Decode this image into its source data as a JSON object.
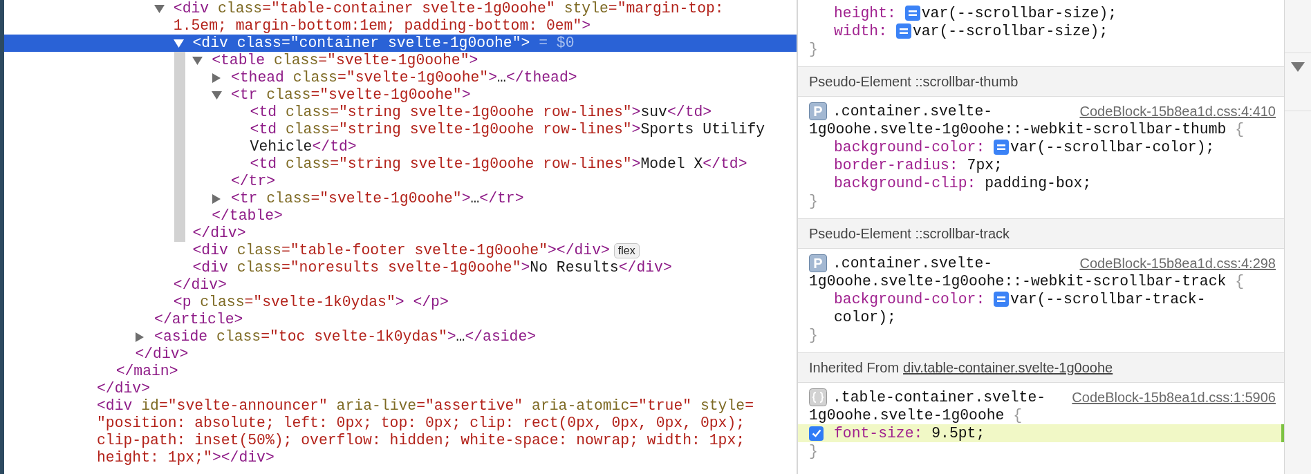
{
  "dom_tree": [
    {
      "children": [
        {
          "children": [
            {
              "children": [
                {
                  "children": [
                    {
                      "selected": false,
                      "expanded": true,
                      "lines": [
                        [
                          {
                            "kind": "tag",
                            "text": "<div"
                          },
                          {
                            "kind": "attr",
                            "text": " class"
                          },
                          {
                            "kind": "value",
                            "text": "=\"table-container svelte-1g0oohe\""
                          },
                          {
                            "kind": "attr",
                            "text": " style"
                          },
                          {
                            "kind": "value",
                            "text": "=\"margin-top:"
                          }
                        ],
                        [
                          {
                            "kind": "value",
                            "text": "1.5em; margin-bottom:1em; padding-bottom: 0em\""
                          },
                          {
                            "kind": "tag",
                            "text": ">"
                          }
                        ]
                      ],
                      "children": [
                        {
                          "selected": true,
                          "expanded": true,
                          "lines": [
                            [
                              {
                                "kind": "tag",
                                "text": "<div"
                              },
                              {
                                "kind": "attr",
                                "text": " class"
                              },
                              {
                                "kind": "value",
                                "text": "=\"container svelte-1g0oohe\""
                              },
                              {
                                "kind": "tag",
                                "text": ">"
                              },
                              {
                                "kind": "ref",
                                "text": " = $0"
                              }
                            ]
                          ],
                          "children": [
                            {
                              "selected": false,
                              "expanded": true,
                              "lines": [
                                [
                                  {
                                    "kind": "tag",
                                    "text": "<table"
                                  },
                                  {
                                    "kind": "attr",
                                    "text": " class"
                                  },
                                  {
                                    "kind": "value",
                                    "text": "=\"svelte-1g0oohe\""
                                  },
                                  {
                                    "kind": "tag",
                                    "text": ">"
                                  }
                                ]
                              ],
                              "children": [
                                {
                                  "selected": false,
                                  "expanded": false,
                                  "lines": [
                                    [
                                      {
                                        "kind": "tag",
                                        "text": "<thead"
                                      },
                                      {
                                        "kind": "attr",
                                        "text": " class"
                                      },
                                      {
                                        "kind": "value",
                                        "text": "=\"svelte-1g0oohe\""
                                      },
                                      {
                                        "kind": "tag",
                                        "text": ">"
                                      },
                                      {
                                        "kind": "text",
                                        "text": "…"
                                      },
                                      {
                                        "kind": "tag",
                                        "text": "</thead>"
                                      }
                                    ]
                                  ]
                                },
                                {
                                  "selected": false,
                                  "expanded": true,
                                  "lines": [
                                    [
                                      {
                                        "kind": "tag",
                                        "text": "<tr"
                                      },
                                      {
                                        "kind": "attr",
                                        "text": " class"
                                      },
                                      {
                                        "kind": "value",
                                        "text": "=\"svelte-1g0oohe\""
                                      },
                                      {
                                        "kind": "tag",
                                        "text": ">"
                                      }
                                    ]
                                  ],
                                  "children": [
                                    {
                                      "selected": false,
                                      "lines": [
                                        [
                                          {
                                            "kind": "tag",
                                            "text": "<td"
                                          },
                                          {
                                            "kind": "attr",
                                            "text": " class"
                                          },
                                          {
                                            "kind": "value",
                                            "text": "=\"string svelte-1g0oohe row-lines\""
                                          },
                                          {
                                            "kind": "tag",
                                            "text": ">"
                                          },
                                          {
                                            "kind": "text",
                                            "text": "suv"
                                          },
                                          {
                                            "kind": "tag",
                                            "text": "</td>"
                                          }
                                        ]
                                      ]
                                    },
                                    {
                                      "selected": false,
                                      "lines": [
                                        [
                                          {
                                            "kind": "tag",
                                            "text": "<td"
                                          },
                                          {
                                            "kind": "attr",
                                            "text": " class"
                                          },
                                          {
                                            "kind": "value",
                                            "text": "=\"string svelte-1g0oohe row-lines\""
                                          },
                                          {
                                            "kind": "tag",
                                            "text": ">"
                                          },
                                          {
                                            "kind": "text",
                                            "text": "Sports Utilify"
                                          }
                                        ],
                                        [
                                          {
                                            "kind": "text",
                                            "text": "Vehicle"
                                          },
                                          {
                                            "kind": "tag",
                                            "text": "</td>"
                                          }
                                        ]
                                      ]
                                    },
                                    {
                                      "selected": false,
                                      "lines": [
                                        [
                                          {
                                            "kind": "tag",
                                            "text": "<td"
                                          },
                                          {
                                            "kind": "attr",
                                            "text": " class"
                                          },
                                          {
                                            "kind": "value",
                                            "text": "=\"string svelte-1g0oohe row-lines\""
                                          },
                                          {
                                            "kind": "tag",
                                            "text": ">"
                                          },
                                          {
                                            "kind": "text",
                                            "text": "Model X"
                                          },
                                          {
                                            "kind": "tag",
                                            "text": "</td>"
                                          }
                                        ]
                                      ]
                                    }
                                  ],
                                  "close": [
                                    {
                                      "kind": "tag",
                                      "text": "</tr>"
                                    }
                                  ]
                                },
                                {
                                  "selected": false,
                                  "expanded": false,
                                  "lines": [
                                    [
                                      {
                                        "kind": "tag",
                                        "text": "<tr"
                                      },
                                      {
                                        "kind": "attr",
                                        "text": " class"
                                      },
                                      {
                                        "kind": "value",
                                        "text": "=\"svelte-1g0oohe\""
                                      },
                                      {
                                        "kind": "tag",
                                        "text": ">"
                                      },
                                      {
                                        "kind": "text",
                                        "text": "…"
                                      },
                                      {
                                        "kind": "tag",
                                        "text": "</tr>"
                                      }
                                    ]
                                  ]
                                }
                              ],
                              "close": [
                                {
                                  "kind": "tag",
                                  "text": "</table>"
                                }
                              ]
                            }
                          ],
                          "close": [
                            {
                              "kind": "tag",
                              "text": "</div>"
                            }
                          ]
                        },
                        {
                          "selected": false,
                          "badge": "flex",
                          "lines": [
                            [
                              {
                                "kind": "tag",
                                "text": "<div"
                              },
                              {
                                "kind": "attr",
                                "text": " class"
                              },
                              {
                                "kind": "value",
                                "text": "=\"table-footer svelte-1g0oohe\""
                              },
                              {
                                "kind": "tag",
                                "text": "></div>"
                              }
                            ]
                          ]
                        },
                        {
                          "selected": false,
                          "lines": [
                            [
                              {
                                "kind": "tag",
                                "text": "<div"
                              },
                              {
                                "kind": "attr",
                                "text": " class"
                              },
                              {
                                "kind": "value",
                                "text": "=\"noresults svelte-1g0oohe\""
                              },
                              {
                                "kind": "tag",
                                "text": ">"
                              },
                              {
                                "kind": "text",
                                "text": "No Results"
                              },
                              {
                                "kind": "tag",
                                "text": "</div>"
                              }
                            ]
                          ]
                        }
                      ],
                      "close": [
                        {
                          "kind": "tag",
                          "text": "</div>"
                        }
                      ]
                    },
                    {
                      "selected": false,
                      "lines": [
                        [
                          {
                            "kind": "tag",
                            "text": "<p"
                          },
                          {
                            "kind": "attr",
                            "text": " class"
                          },
                          {
                            "kind": "value",
                            "text": "=\"svelte-1k0ydas\""
                          },
                          {
                            "kind": "tag",
                            "text": "> </p>"
                          }
                        ]
                      ]
                    }
                  ],
                  "close": [
                    {
                      "kind": "tag",
                      "text": "</article>"
                    }
                  ]
                },
                {
                  "selected": false,
                  "expanded": false,
                  "lines": [
                    [
                      {
                        "kind": "tag",
                        "text": "<aside"
                      },
                      {
                        "kind": "attr",
                        "text": " class"
                      },
                      {
                        "kind": "value",
                        "text": "=\"toc svelte-1k0ydas\""
                      },
                      {
                        "kind": "tag",
                        "text": ">"
                      },
                      {
                        "kind": "text",
                        "text": "…"
                      },
                      {
                        "kind": "tag",
                        "text": "</aside>"
                      }
                    ]
                  ]
                }
              ],
              "close": [
                {
                  "kind": "tag",
                  "text": "</div>"
                }
              ]
            }
          ],
          "close": [
            {
              "kind": "tag",
              "text": "</main>"
            }
          ]
        }
      ],
      "close": [
        {
          "kind": "tag",
          "text": "</div>"
        }
      ]
    },
    {
      "selected": false,
      "lines": [
        [
          {
            "kind": "tag",
            "text": "<div"
          },
          {
            "kind": "attr",
            "text": " id"
          },
          {
            "kind": "value",
            "text": "=\"svelte-announcer\""
          },
          {
            "kind": "attr",
            "text": " aria-live"
          },
          {
            "kind": "value",
            "text": "=\"assertive\""
          },
          {
            "kind": "attr",
            "text": " aria-atomic"
          },
          {
            "kind": "value",
            "text": "=\"true\""
          },
          {
            "kind": "attr",
            "text": " style"
          },
          {
            "kind": "value",
            "text": "="
          }
        ],
        [
          {
            "kind": "value",
            "text": "\"position: absolute; left: 0px; top: 0px; clip: rect(0px, 0px, 0px, 0px);"
          }
        ],
        [
          {
            "kind": "value",
            "text": "clip-path: inset(50%); overflow: hidden; white-space: nowrap; width: 1px;"
          }
        ],
        [
          {
            "kind": "value",
            "text": "height: 1px;\""
          },
          {
            "kind": "tag",
            "text": "></div>"
          }
        ]
      ]
    }
  ],
  "styles": [
    {
      "kind": "rule",
      "declarations": [
        {
          "property": "height:",
          "value": [
            "var(--scrollbar-size);"
          ],
          "var_icon": true
        },
        {
          "property": "width:",
          "value": [
            "var(--scrollbar-size);"
          ],
          "var_icon": true
        }
      ],
      "close": "}"
    },
    {
      "kind": "header",
      "label": "Pseudo-Element ::scrollbar-thumb"
    },
    {
      "kind": "pseudo-rule",
      "badge": "P",
      "selector": [
        ".container.svelte-",
        "1g0oohe.svelte-1g0oohe::-webkit-scrollbar-thumb"
      ],
      "open": "{",
      "source": "CodeBlock-15b8ea1d.css:4:410",
      "declarations": [
        {
          "property": "background-color:",
          "value": [
            "var(--scrollbar-color);"
          ],
          "var_icon": true
        },
        {
          "property": "border-radius:",
          "value": [
            "7px;"
          ]
        },
        {
          "property": "background-clip:",
          "value": [
            "padding-box;"
          ]
        }
      ],
      "close": "}"
    },
    {
      "kind": "header",
      "label": "Pseudo-Element ::scrollbar-track"
    },
    {
      "kind": "pseudo-rule",
      "badge": "P",
      "selector": [
        ".container.svelte-",
        "1g0oohe.svelte-1g0oohe::-webkit-scrollbar-track"
      ],
      "open": "{",
      "source": "CodeBlock-15b8ea1d.css:4:298",
      "declarations": [
        {
          "property": "background-color:",
          "value": [
            "var(--scrollbar-track-",
            "color);"
          ],
          "var_icon": true
        }
      ],
      "close": "}"
    },
    {
      "kind": "header",
      "label": "Inherited From",
      "link": "div.table-container.svelte-1g0oohe"
    },
    {
      "kind": "inherited-rule",
      "selector": [
        ".table-container.svelte-",
        "1g0oohe.svelte-1g0oohe"
      ],
      "open": "{",
      "source": "CodeBlock-15b8ea1d.css:1:5906",
      "declarations": [
        {
          "property": "font-size:",
          "value": [
            "9.5pt;"
          ],
          "enabled": true,
          "highlighted": true
        }
      ],
      "close": "}"
    }
  ]
}
